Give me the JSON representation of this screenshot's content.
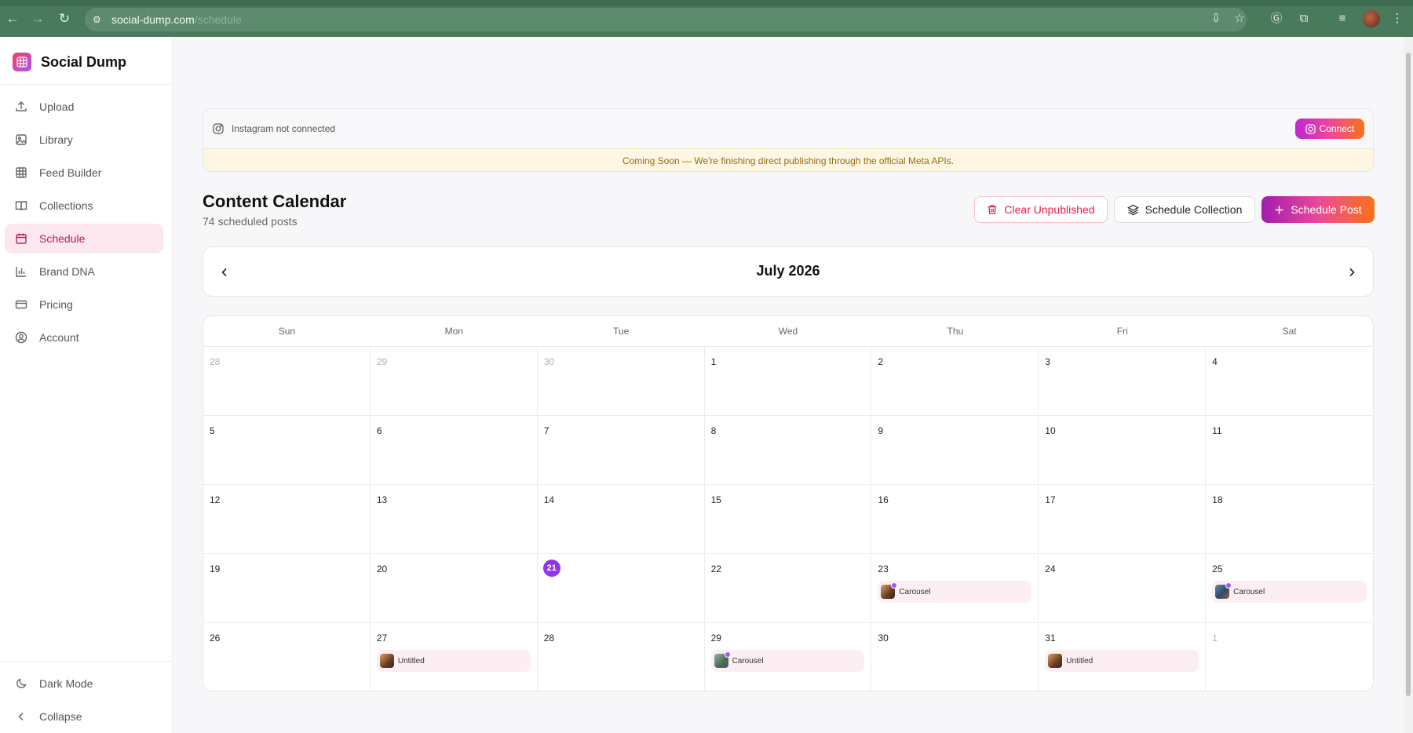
{
  "browser": {
    "url_domain": "social-dump.com",
    "url_path": "/schedule"
  },
  "sidebar": {
    "brand": "Social Dump",
    "items": [
      {
        "label": "Upload",
        "icon": "upload-icon"
      },
      {
        "label": "Library",
        "icon": "image-icon"
      },
      {
        "label": "Feed Builder",
        "icon": "grid-icon"
      },
      {
        "label": "Collections",
        "icon": "book-icon"
      },
      {
        "label": "Schedule",
        "icon": "calendar-icon",
        "active": true
      },
      {
        "label": "Brand DNA",
        "icon": "bar-chart-icon"
      },
      {
        "label": "Pricing",
        "icon": "credit-card-icon"
      },
      {
        "label": "Account",
        "icon": "user-circle-icon"
      }
    ],
    "dark_mode_label": "Dark Mode",
    "collapse_label": "Collapse"
  },
  "instagram": {
    "status": "Instagram not connected",
    "connect_label": "Connect",
    "notice": "Coming Soon — We're finishing direct publishing through the official Meta APIs."
  },
  "header": {
    "title": "Content Calendar",
    "subtitle": "74 scheduled posts",
    "clear_label": "Clear Unpublished",
    "collection_label": "Schedule Collection",
    "schedule_label": "Schedule Post"
  },
  "calendar": {
    "month_label": "July 2026",
    "weekdays": [
      "Sun",
      "Mon",
      "Tue",
      "Wed",
      "Thu",
      "Fri",
      "Sat"
    ],
    "days": [
      {
        "d": "28",
        "other": true
      },
      {
        "d": "29",
        "other": true
      },
      {
        "d": "30",
        "other": true
      },
      {
        "d": "1"
      },
      {
        "d": "2"
      },
      {
        "d": "3"
      },
      {
        "d": "4"
      },
      {
        "d": "5"
      },
      {
        "d": "6"
      },
      {
        "d": "7"
      },
      {
        "d": "8"
      },
      {
        "d": "9"
      },
      {
        "d": "10"
      },
      {
        "d": "11"
      },
      {
        "d": "12"
      },
      {
        "d": "13"
      },
      {
        "d": "14"
      },
      {
        "d": "15"
      },
      {
        "d": "16"
      },
      {
        "d": "17"
      },
      {
        "d": "18"
      },
      {
        "d": "19"
      },
      {
        "d": "20"
      },
      {
        "d": "21",
        "today": true
      },
      {
        "d": "22"
      },
      {
        "d": "23",
        "event": "Carousel",
        "thumb": "warm"
      },
      {
        "d": "24"
      },
      {
        "d": "25",
        "event": "Carousel",
        "thumb": "cool"
      },
      {
        "d": "26"
      },
      {
        "d": "27",
        "event": "Untitled",
        "thumb": "warm"
      },
      {
        "d": "28"
      },
      {
        "d": "29",
        "event": "Carousel",
        "thumb": "green"
      },
      {
        "d": "30"
      },
      {
        "d": "31",
        "event": "Untitled",
        "thumb": "warm"
      },
      {
        "d": "1",
        "other": true
      }
    ]
  },
  "colors": {
    "accent": "#9333ea",
    "active_bg": "#fde7ef",
    "active_text": "#be185d",
    "event_bg": "#fdeef4",
    "danger": "#e11d48",
    "browser_bar": "#4a7a5c"
  }
}
